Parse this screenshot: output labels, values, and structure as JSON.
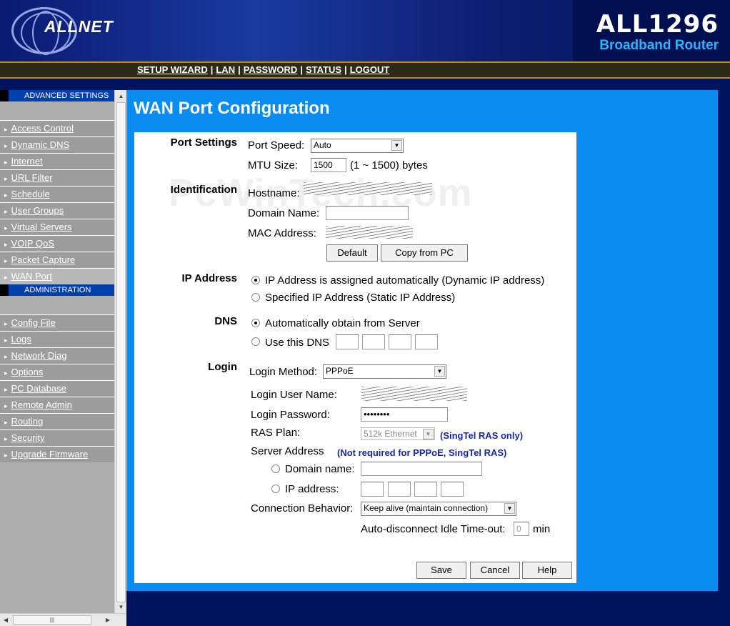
{
  "header": {
    "logo": "ALLNET",
    "model": "ALL1296",
    "subtitle": "Broadband Router"
  },
  "topnav": [
    "SETUP WIZARD",
    "LAN",
    "PASSWORD",
    "STATUS",
    "LOGOUT"
  ],
  "sidebar": {
    "advanced_title": "ADVANCED SETTINGS",
    "advanced_items": [
      "Access Control",
      "Dynamic DNS",
      "Internet",
      "URL Filter",
      "Schedule",
      "User Groups",
      "Virtual Servers",
      "VOIP QoS",
      "Packet Capture",
      "WAN Port"
    ],
    "admin_title": "ADMINISTRATION",
    "admin_items": [
      "Config File",
      "Logs",
      "Network Diag",
      "Options",
      "PC Database",
      "Remote Admin",
      "Routing",
      "Security",
      "Upgrade Firmware"
    ]
  },
  "page": {
    "title": "WAN Port Configuration",
    "watermark": "PcWinTech.com"
  },
  "port_settings": {
    "label": "Port Settings",
    "speed_label": "Port Speed:",
    "speed_value": "Auto",
    "mtu_label": "MTU Size:",
    "mtu_value": "1500",
    "mtu_hint": "(1 ~ 1500) bytes"
  },
  "identification": {
    "label": "Identification",
    "hostname_label": "Hostname:",
    "domain_label": "Domain Name:",
    "mac_label": "MAC Address:",
    "default_btn": "Default",
    "copy_btn": "Copy from PC"
  },
  "ip_address": {
    "label": "IP Address",
    "opt_dynamic": "IP Address is assigned automatically (Dynamic IP address)",
    "opt_static": "Specified IP Address (Static IP Address)"
  },
  "dns": {
    "label": "DNS",
    "opt_auto": "Automatically obtain from Server",
    "opt_manual": "Use this DNS"
  },
  "login": {
    "label": "Login",
    "method_label": "Login Method:",
    "method_value": "PPPoE",
    "user_label": "Login User Name:",
    "password_label": "Login Password:",
    "password_value": "••••••••",
    "ras_label": "RAS Plan:",
    "ras_value": "512k Ethernet",
    "ras_note": "(SingTel RAS only)",
    "server_label": "Server Address",
    "server_note": "(Not required for PPPoE, SingTel RAS)",
    "domain_opt": "Domain name:",
    "ip_opt": "IP address:",
    "behavior_label": "Connection Behavior:",
    "behavior_value": "Keep alive (maintain connection)",
    "idle_label": "Auto-disconnect Idle Time-out:",
    "idle_value": "0",
    "idle_unit": "min"
  },
  "buttons": {
    "save": "Save",
    "cancel": "Cancel",
    "help": "Help"
  }
}
